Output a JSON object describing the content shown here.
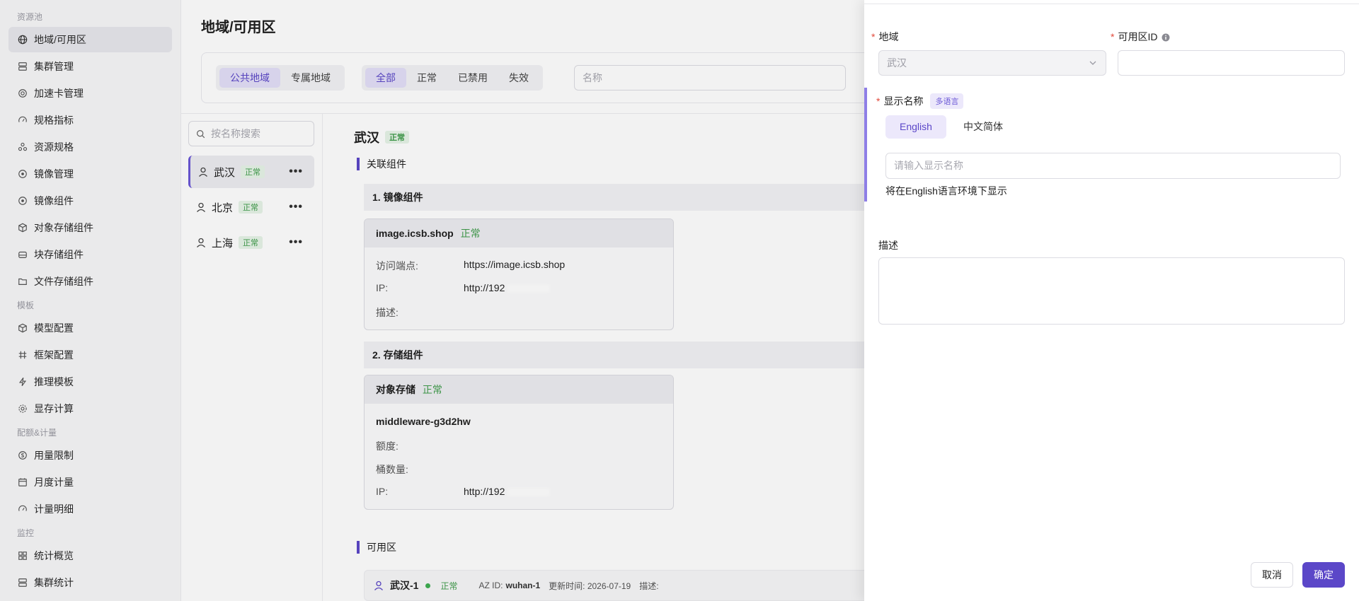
{
  "sidebar": {
    "sections": [
      {
        "label": "资源池"
      },
      {
        "label": "模板"
      },
      {
        "label": "配额&计量"
      },
      {
        "label": "监控"
      }
    ],
    "items": [
      {
        "label": "地域/可用区",
        "icon": "globe-icon"
      },
      {
        "label": "集群管理",
        "icon": "server-icon"
      },
      {
        "label": "加速卡管理",
        "icon": "chip-icon"
      },
      {
        "label": "规格指标",
        "icon": "gauge-icon"
      },
      {
        "label": "资源规格",
        "icon": "nodes-icon"
      },
      {
        "label": "镜像管理",
        "icon": "target-icon"
      },
      {
        "label": "镜像组件",
        "icon": "target-icon"
      },
      {
        "label": "对象存储组件",
        "icon": "cube-icon"
      },
      {
        "label": "块存储组件",
        "icon": "disk-icon"
      },
      {
        "label": "文件存储组件",
        "icon": "folder-icon"
      },
      {
        "label": "模型配置",
        "icon": "cube-icon"
      },
      {
        "label": "框架配置",
        "icon": "hash-icon"
      },
      {
        "label": "推理模板",
        "icon": "bolt-icon"
      },
      {
        "label": "显存计算",
        "icon": "gear-icon"
      },
      {
        "label": "用量限制",
        "icon": "coin-icon"
      },
      {
        "label": "月度计量",
        "icon": "calendar-icon"
      },
      {
        "label": "计量明细",
        "icon": "gauge-icon"
      },
      {
        "label": "统计概览",
        "icon": "grid-icon"
      },
      {
        "label": "集群统计",
        "icon": "server-icon"
      }
    ]
  },
  "main": {
    "title": "地域/可用区",
    "region_tabs": [
      "公共地域",
      "专属地域"
    ],
    "status_tabs": [
      "全部",
      "正常",
      "已禁用",
      "失效"
    ],
    "search_placeholder": "名称",
    "list_search_placeholder": "按名称搜索",
    "regions": [
      {
        "name": "武汉",
        "status": "正常"
      },
      {
        "name": "北京",
        "status": "正常"
      },
      {
        "name": "上海",
        "status": "正常"
      }
    ],
    "more_icon": "•••"
  },
  "detail": {
    "name": "武汉",
    "status": "正常",
    "section_related": "关联组件",
    "group1": "1. 镜像组件",
    "image_card": {
      "name": "image.icsb.shop",
      "status": "正常",
      "endpoint_label": "访问端点:",
      "endpoint": "https://image.icsb.shop",
      "ip_label": "IP:",
      "ip": "http://192",
      "desc_label": "描述:"
    },
    "group2": "2. 存储组件",
    "storage_card": {
      "name": "对象存储",
      "status": "正常",
      "sub": "middleware-g3d2hw",
      "quota_label": "额度:",
      "bucket_label": "桶数量:",
      "ip_label": "IP:",
      "ip": "http://192"
    },
    "section_az": "可用区",
    "az": {
      "name": "武汉-1",
      "status": "正常",
      "id_label": "AZ ID:",
      "id": "wuhan-1",
      "updated": "更新时间: 2026-07-19",
      "desc": "描述:"
    }
  },
  "drawer": {
    "region_label": "地域",
    "region_value": "武汉",
    "az_id_label": "可用区ID",
    "display_name_label": "显示名称",
    "multilang_badge": "多语言",
    "lang_tabs": [
      "English",
      "中文简体"
    ],
    "display_name_placeholder": "请输入显示名称",
    "hint": "将在English语言环境下显示",
    "desc_label": "描述",
    "cancel": "取消",
    "confirm": "确定"
  }
}
